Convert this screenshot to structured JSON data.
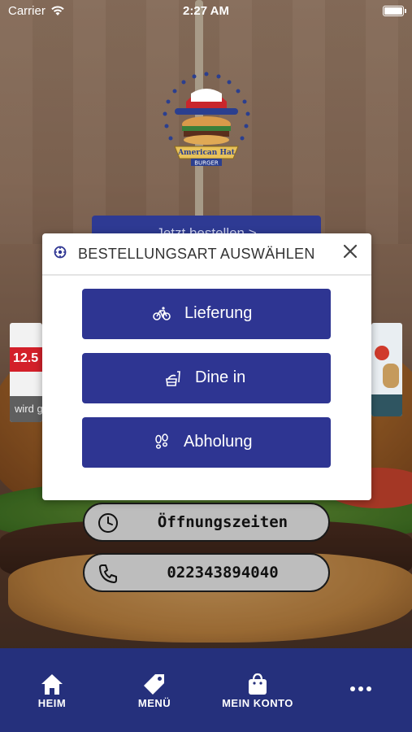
{
  "status_bar": {
    "carrier": "Carrier",
    "time": "2:27 AM"
  },
  "logo": {
    "name": "American Hat",
    "sub": "BURGER"
  },
  "background": {
    "order_button_label": "Jetzt bestellen >",
    "card_price": "12.5",
    "card_caption": "wird g"
  },
  "modal": {
    "title": "BESTELLUNGSART AUSWÄHLEN",
    "options": [
      {
        "label": "Lieferung",
        "icon": "bicycle-icon"
      },
      {
        "label": "Dine in",
        "icon": "fastfood-icon"
      },
      {
        "label": "Abholung",
        "icon": "footsteps-icon"
      }
    ]
  },
  "info": {
    "hours_label": "Öffnungszeiten",
    "phone": "022343894040"
  },
  "tabbar": {
    "items": [
      {
        "label": "HEIM",
        "icon": "home-icon"
      },
      {
        "label": "MENÜ",
        "icon": "tag-icon"
      },
      {
        "label": "MEIN KONTO",
        "icon": "shopping-bag-icon"
      },
      {
        "label": "",
        "icon": "more-dots-icon"
      }
    ]
  },
  "colors": {
    "primary": "#2e3592",
    "tabbar": "#25307c",
    "pill": "#bdbdbd"
  }
}
